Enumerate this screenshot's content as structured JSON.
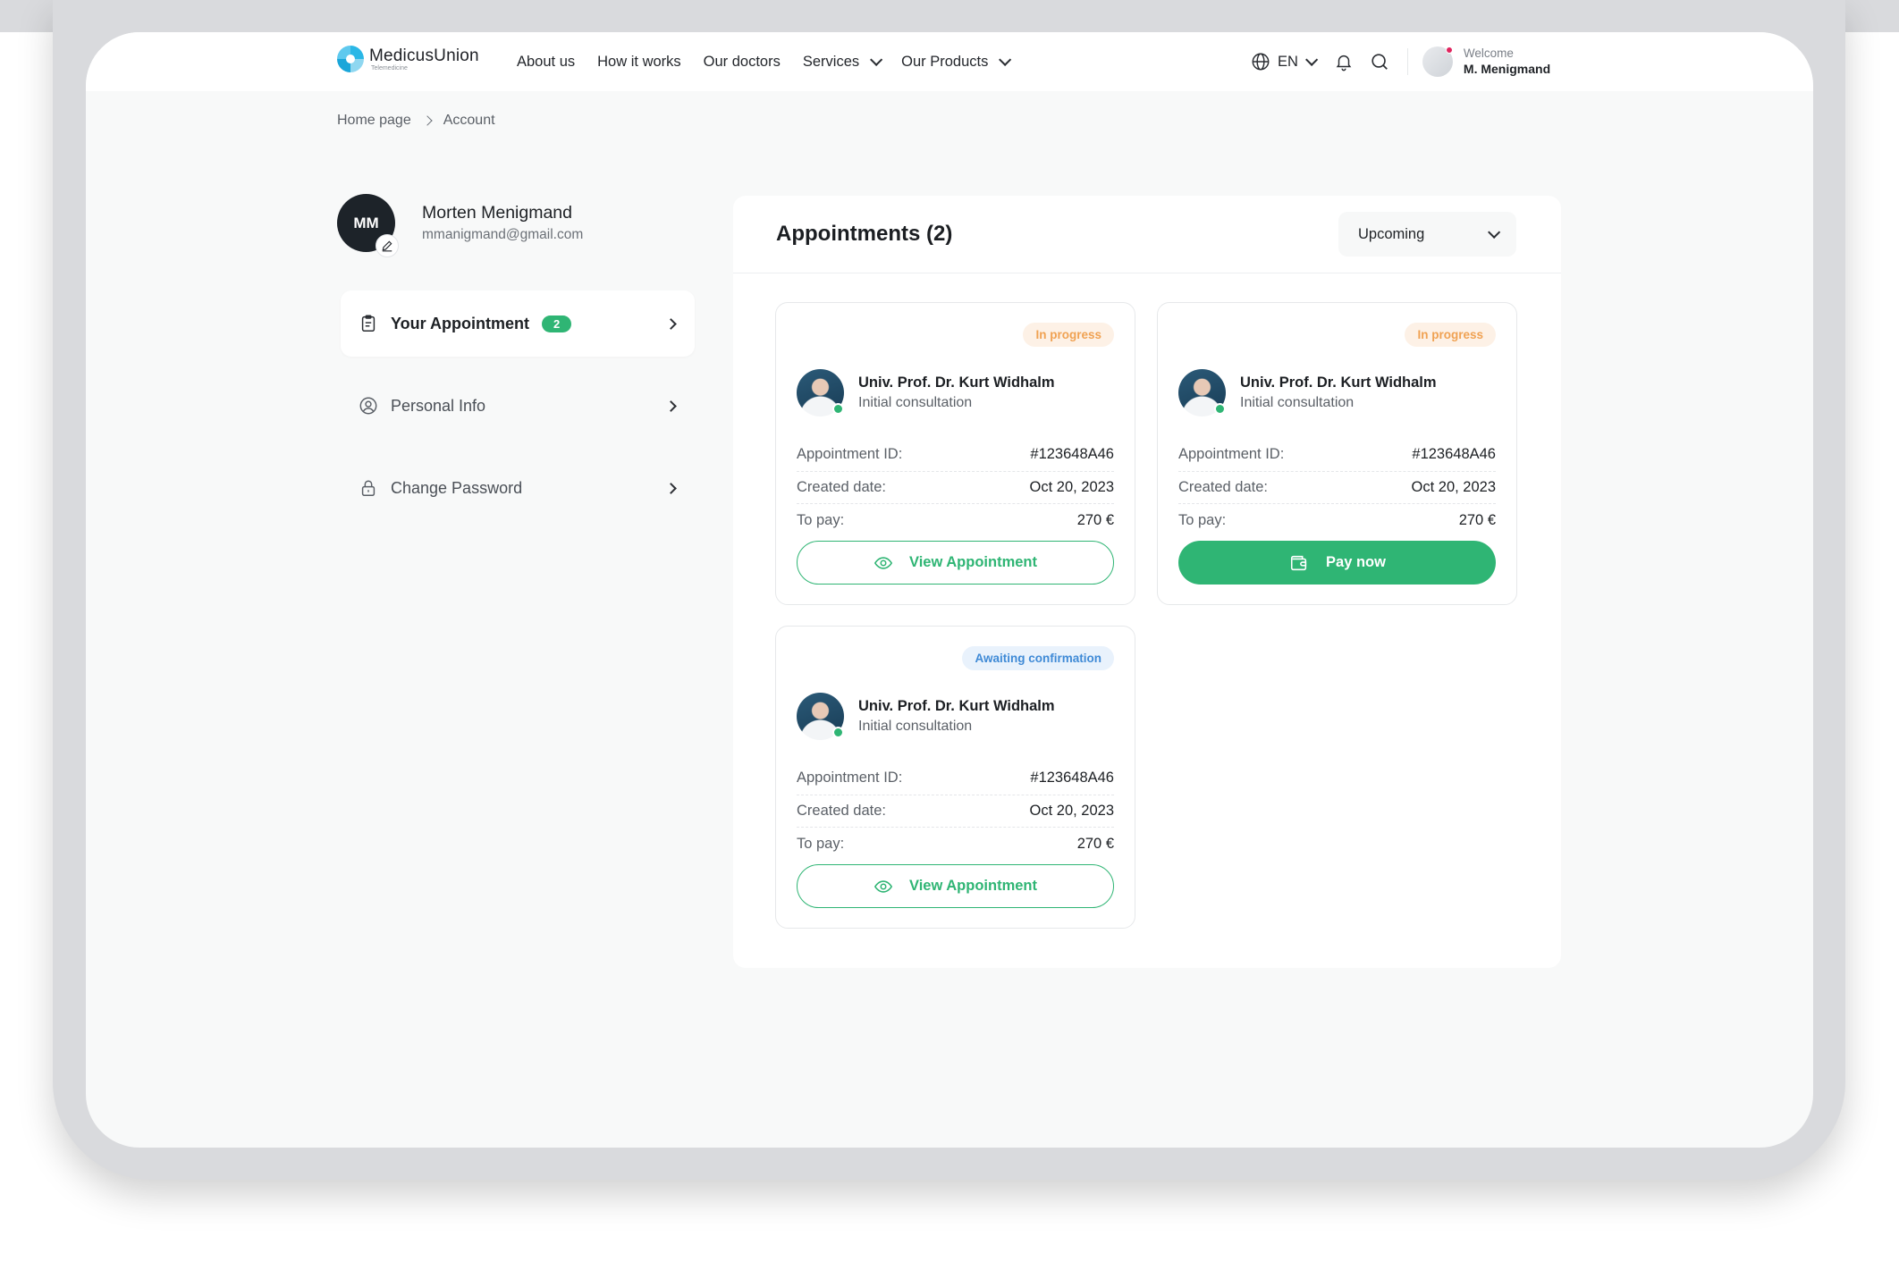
{
  "brand": {
    "name": "MedicusUnion",
    "subtitle": "Telemedicine"
  },
  "nav": {
    "items": [
      {
        "label": "About us"
      },
      {
        "label": "How it works"
      },
      {
        "label": "Our doctors"
      },
      {
        "label": "Services"
      },
      {
        "label": "Our Products"
      }
    ],
    "language": "EN"
  },
  "user": {
    "welcome": "Welcome",
    "name": "M. Menigmand"
  },
  "breadcrumb": {
    "home": "Home page",
    "current": "Account"
  },
  "profile": {
    "initials": "MM",
    "name": "Morten Menigmand",
    "email": "mmanigmand@gmail.com"
  },
  "sidebar": {
    "items": [
      {
        "label": "Your Appointment",
        "badge": "2"
      },
      {
        "label": "Personal Info"
      },
      {
        "label": "Change Password"
      }
    ]
  },
  "appointments": {
    "title": "Appointments (2)",
    "filter": "Upcoming",
    "labels": {
      "id": "Appointment ID:",
      "created": "Created date:",
      "pay": "To pay:"
    },
    "cards": [
      {
        "status": "In progress",
        "doctor": "Univ. Prof. Dr. Kurt Widhalm",
        "type": "Initial consultation",
        "id": "#123648A46",
        "created": "Oct 20, 2023",
        "pay": "270 €",
        "action": "View Appointment"
      },
      {
        "status": "In progress",
        "doctor": "Univ. Prof. Dr. Kurt Widhalm",
        "type": "Initial consultation",
        "id": "#123648A46",
        "created": "Oct 20, 2023",
        "pay": "270 €",
        "action": "Pay now"
      },
      {
        "status": "Awaiting confirmation",
        "doctor": "Univ. Prof. Dr. Kurt Widhalm",
        "type": "Initial consultation",
        "id": "#123648A46",
        "created": "Oct 20, 2023",
        "pay": "270 €",
        "action": "View Appointment"
      }
    ]
  },
  "colors": {
    "accent": "#2fb574",
    "progress": "#f0a253",
    "awaiting": "#3f8ad6",
    "notification": "#e0245e"
  }
}
